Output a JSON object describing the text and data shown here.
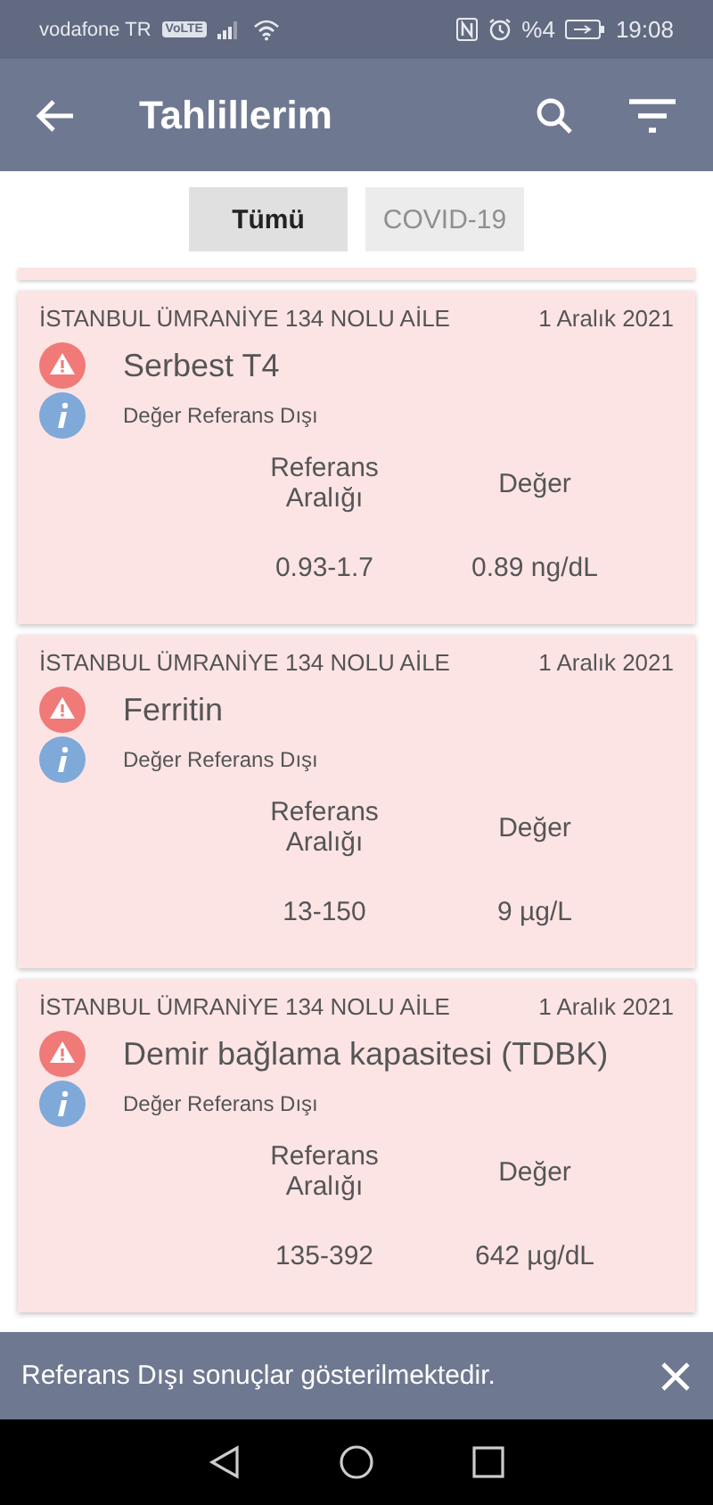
{
  "status_bar": {
    "carrier": "vodafone TR",
    "volte": "VoLTE",
    "battery": "%4",
    "time": "19:08"
  },
  "app_bar": {
    "title": "Tahlillerim"
  },
  "tabs": [
    {
      "label": "Tümü",
      "selected": true
    },
    {
      "label": "COVID-19",
      "selected": false
    }
  ],
  "results": [
    {
      "institution": "İSTANBUL ÜMRANİYE 134 NOLU AİLE",
      "date": "1 Aralık 2021",
      "test": "Serbest T4",
      "status": "Değer Referans Dışı",
      "range_header": "Referans Aralığı",
      "value_header": "Değer",
      "range": "0.93-1.7",
      "value": "0.89 ng/dL"
    },
    {
      "institution": "İSTANBUL ÜMRANİYE 134 NOLU AİLE",
      "date": "1 Aralık 2021",
      "test": "Ferritin",
      "status": "Değer Referans Dışı",
      "range_header": "Referans Aralığı",
      "value_header": "Değer",
      "range": "13-150",
      "value": "9 µg/L"
    },
    {
      "institution": "İSTANBUL ÜMRANİYE 134 NOLU AİLE",
      "date": "1 Aralık 2021",
      "test": "Demir bağlama kapasitesi (TDBK)",
      "status": "Değer Referans Dışı",
      "range_header": "Referans Aralığı",
      "value_header": "Değer",
      "range": "135-392",
      "value": "642 µg/dL"
    }
  ],
  "snackbar": {
    "message": "Referans Dışı sonuçlar gösterilmektedir."
  }
}
